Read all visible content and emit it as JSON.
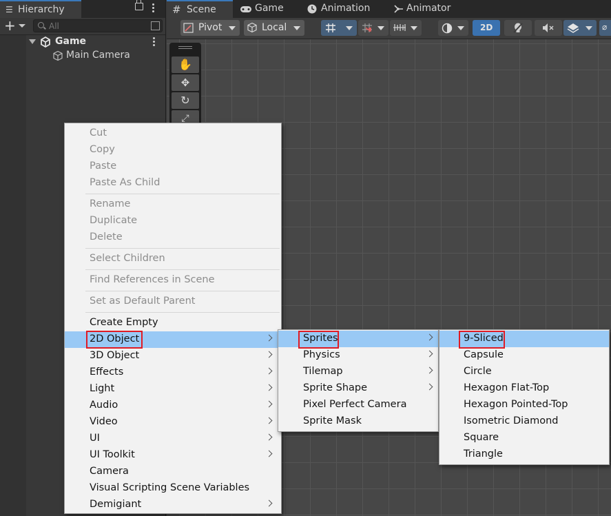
{
  "hierarchy": {
    "tab_title": "Hierarchy",
    "search_placeholder": "All",
    "scene_name": "Game",
    "objects": [
      "Main Camera"
    ]
  },
  "scene_tabs": [
    {
      "label": "Scene",
      "icon": "hash-icon"
    },
    {
      "label": "Game",
      "icon": "gamepad-icon"
    },
    {
      "label": "Animation",
      "icon": "clock-icon"
    },
    {
      "label": "Animator",
      "icon": "animator-icon"
    }
  ],
  "toolbar": {
    "pivot_label": "Pivot",
    "local_label": "Local",
    "mode_2d_label": "2D"
  },
  "context_menu": {
    "groups": [
      [
        "Cut",
        "Copy",
        "Paste",
        "Paste As Child"
      ],
      [
        "Rename",
        "Duplicate",
        "Delete"
      ],
      [
        "Select Children"
      ],
      [
        "Find References in Scene"
      ],
      [
        "Set as Default Parent"
      ],
      [
        "Create Empty",
        "2D Object",
        "3D Object",
        "Effects",
        "Light",
        "Audio",
        "Video",
        "UI",
        "UI Toolkit",
        "Camera",
        "Visual Scripting Scene Variables",
        "Demigiant"
      ]
    ],
    "highlighted": "2D Object"
  },
  "submenu_2d": {
    "items": [
      "Sprites",
      "Physics",
      "Tilemap",
      "Sprite Shape",
      "Pixel Perfect Camera",
      "Sprite Mask"
    ],
    "highlighted": "Sprites"
  },
  "submenu_sprites": {
    "items": [
      "9-Sliced",
      "Capsule",
      "Circle",
      "Hexagon Flat-Top",
      "Hexagon Pointed-Top",
      "Isometric Diamond",
      "Square",
      "Triangle"
    ],
    "highlighted": "9-Sliced"
  },
  "colors": {
    "highlight": "#99c9f5",
    "annotation_box": "#e01b24",
    "editor_bg": "#383838",
    "menu_bg": "#f2f2f2"
  }
}
